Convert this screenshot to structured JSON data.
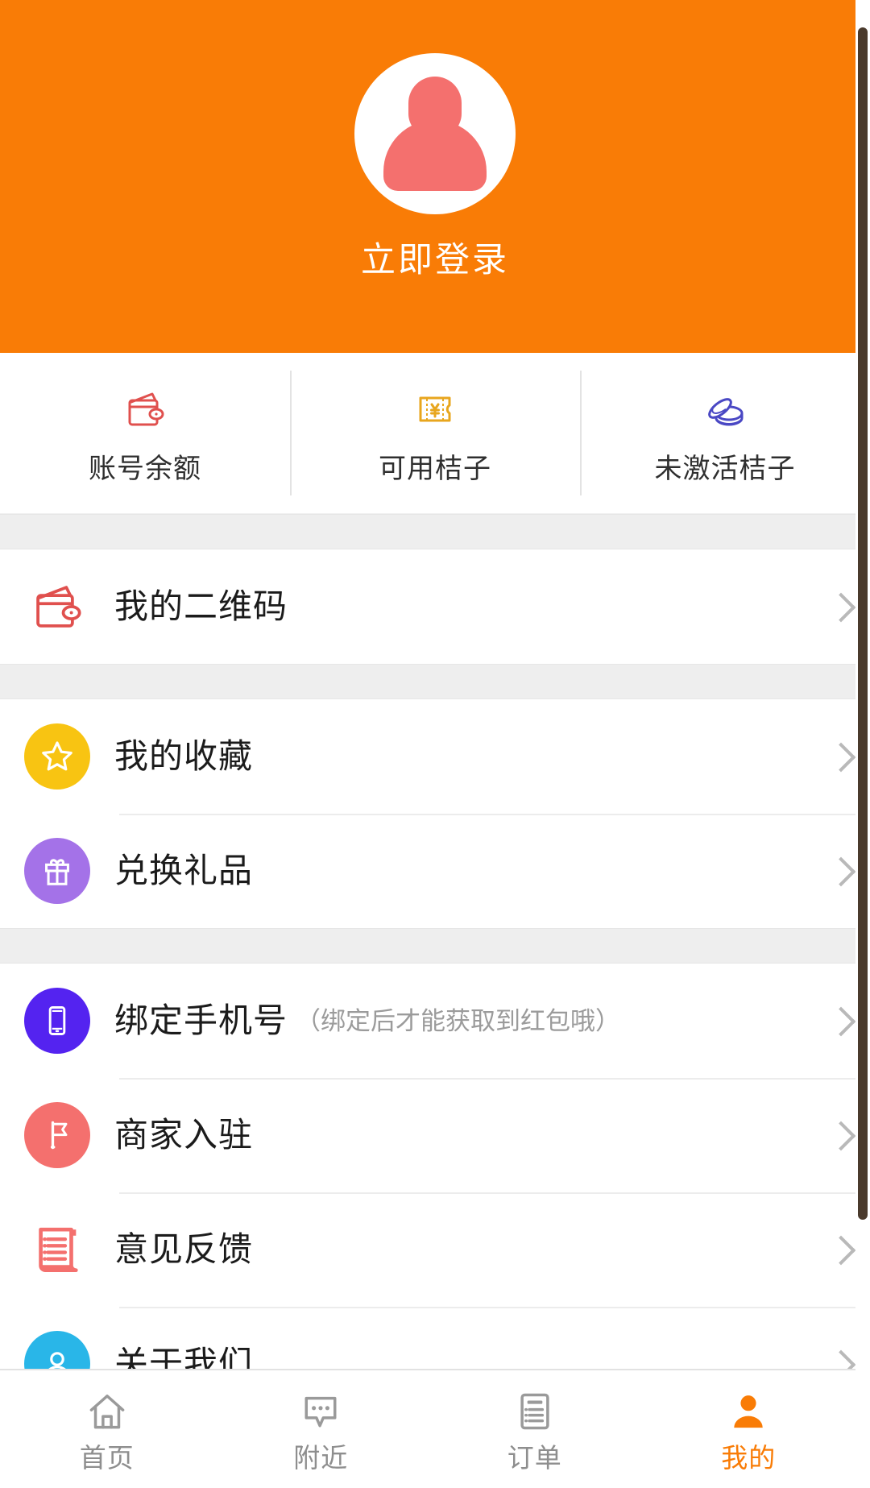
{
  "header": {
    "background_color": "#f97c06",
    "avatar_icon": "user-avatar-placeholder",
    "login_label": "立即登录"
  },
  "stats": {
    "items": [
      {
        "icon": "wallet-icon",
        "label": "账号余额",
        "color": "#e0504e"
      },
      {
        "icon": "coupon-yen-icon",
        "label": "可用桔子",
        "color": "#e8a61e"
      },
      {
        "icon": "coins-stack-icon",
        "label": "未激活桔子",
        "color": "#4a48c4"
      }
    ]
  },
  "menu_groups": [
    {
      "rows": [
        {
          "icon": "wallet-outline-icon",
          "label": "我的二维码",
          "hint": "",
          "icon_bg": "none",
          "icon_color": "#e0504e",
          "chevron": "chevron-right-icon"
        }
      ]
    },
    {
      "rows": [
        {
          "icon": "star-icon",
          "label": "我的收藏",
          "hint": "",
          "icon_bg": "#f8c412",
          "icon_color": "#ffffff",
          "chevron": "chevron-right-icon"
        },
        {
          "icon": "gift-icon",
          "label": "兑换礼品",
          "hint": "",
          "icon_bg": "#a472e8",
          "icon_color": "#ffffff",
          "chevron": "chevron-right-icon"
        }
      ]
    },
    {
      "rows": [
        {
          "icon": "mobile-phone-icon",
          "label": "绑定手机号",
          "hint": "（绑定后才能获取到红包哦）",
          "icon_bg": "#5423f0",
          "icon_color": "#ffffff",
          "chevron": "chevron-right-icon"
        },
        {
          "icon": "flag-icon",
          "label": "商家入驻",
          "hint": "",
          "icon_bg": "#f4706e",
          "icon_color": "#ffffff",
          "chevron": "chevron-right-icon"
        },
        {
          "icon": "feedback-scroll-icon",
          "label": "意见反馈",
          "hint": "",
          "icon_bg": "none",
          "icon_color": "#f4706e",
          "chevron": "chevron-right-icon"
        },
        {
          "icon": "person-circle-icon",
          "label": "关于我们",
          "hint": "",
          "icon_bg": "#29b6e8",
          "icon_color": "#ffffff",
          "chevron": "chevron-right-icon"
        }
      ]
    }
  ],
  "tabbar": {
    "active_color": "#f97c06",
    "inactive_color": "#8e8e8e",
    "tabs": [
      {
        "icon": "home-icon",
        "label": "首页",
        "active": false
      },
      {
        "icon": "chat-bubble-icon",
        "label": "附近",
        "active": false
      },
      {
        "icon": "order-list-icon",
        "label": "订单",
        "active": false
      },
      {
        "icon": "profile-person-icon",
        "label": "我的",
        "active": true
      }
    ]
  },
  "scrollbar": {
    "visible": true,
    "color": "#4a3a2c"
  }
}
